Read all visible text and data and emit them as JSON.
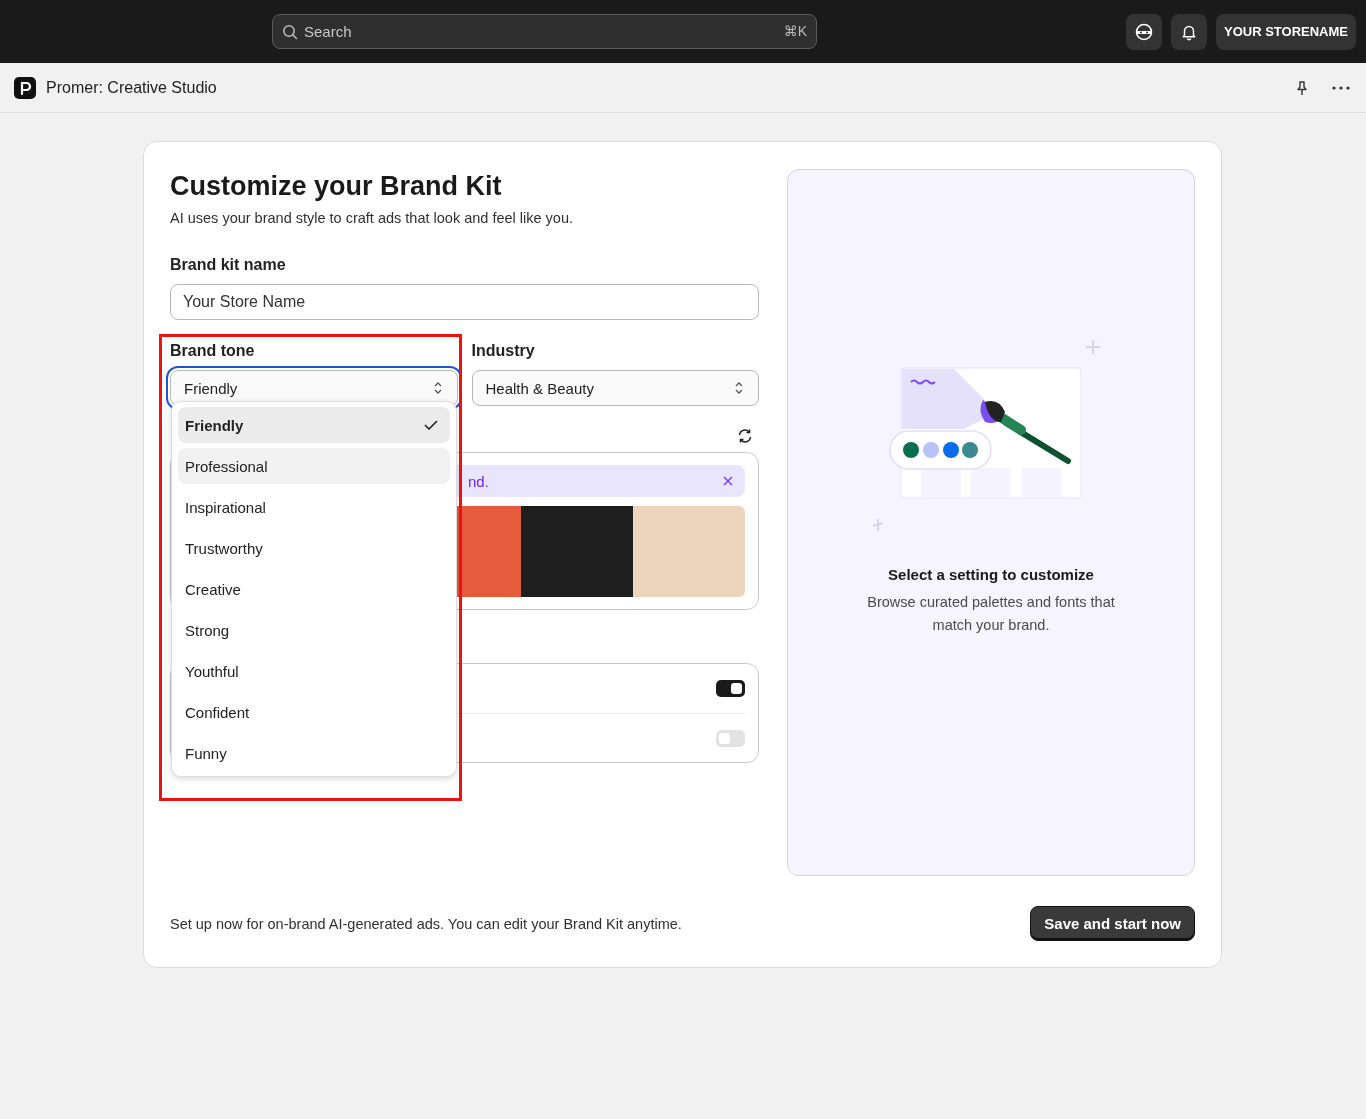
{
  "top_bar": {
    "search": {
      "placeholder": "Search",
      "shortcut": "⌘K"
    },
    "store_button": "YOUR STORENAME"
  },
  "app_bar": {
    "title": "Promer: Creative Studio"
  },
  "form": {
    "title": "Customize your Brand Kit",
    "subtitle": "AI uses your brand style to craft ads that look and feel like you.",
    "name_field": {
      "label": "Brand kit name",
      "value": "Your Store Name"
    },
    "brand_tone": {
      "label": "Brand tone",
      "value": "Friendly",
      "expanded": true,
      "highlighted": true,
      "options": [
        {
          "label": "Friendly",
          "selected": true,
          "hovered": false
        },
        {
          "label": "Professional",
          "selected": false,
          "hovered": true
        },
        {
          "label": "Inspirational",
          "selected": false,
          "hovered": false
        },
        {
          "label": "Trustworthy",
          "selected": false,
          "hovered": false
        },
        {
          "label": "Creative",
          "selected": false,
          "hovered": false
        },
        {
          "label": "Strong",
          "selected": false,
          "hovered": false
        },
        {
          "label": "Youthful",
          "selected": false,
          "hovered": false
        },
        {
          "label": "Confident",
          "selected": false,
          "hovered": false
        },
        {
          "label": "Funny",
          "selected": false,
          "hovered": false
        }
      ]
    },
    "industry": {
      "label": "Industry",
      "value": "Health & Beauty"
    },
    "palette": {
      "banner": "nd.",
      "swatches": [
        {
          "color": "#e55b3c"
        },
        {
          "color": "#1e1e1e"
        },
        {
          "color": "#ecd4bd"
        }
      ]
    },
    "toggles": [
      {
        "on": true
      },
      {
        "on": false
      }
    ]
  },
  "preview": {
    "title": "Select a setting to customize",
    "description": "Browse curated palettes and fonts that match your brand."
  },
  "footer": {
    "note": "Set up now for on-brand AI-generated ads. You can edit your Brand Kit anytime.",
    "button": "Save and start now"
  }
}
